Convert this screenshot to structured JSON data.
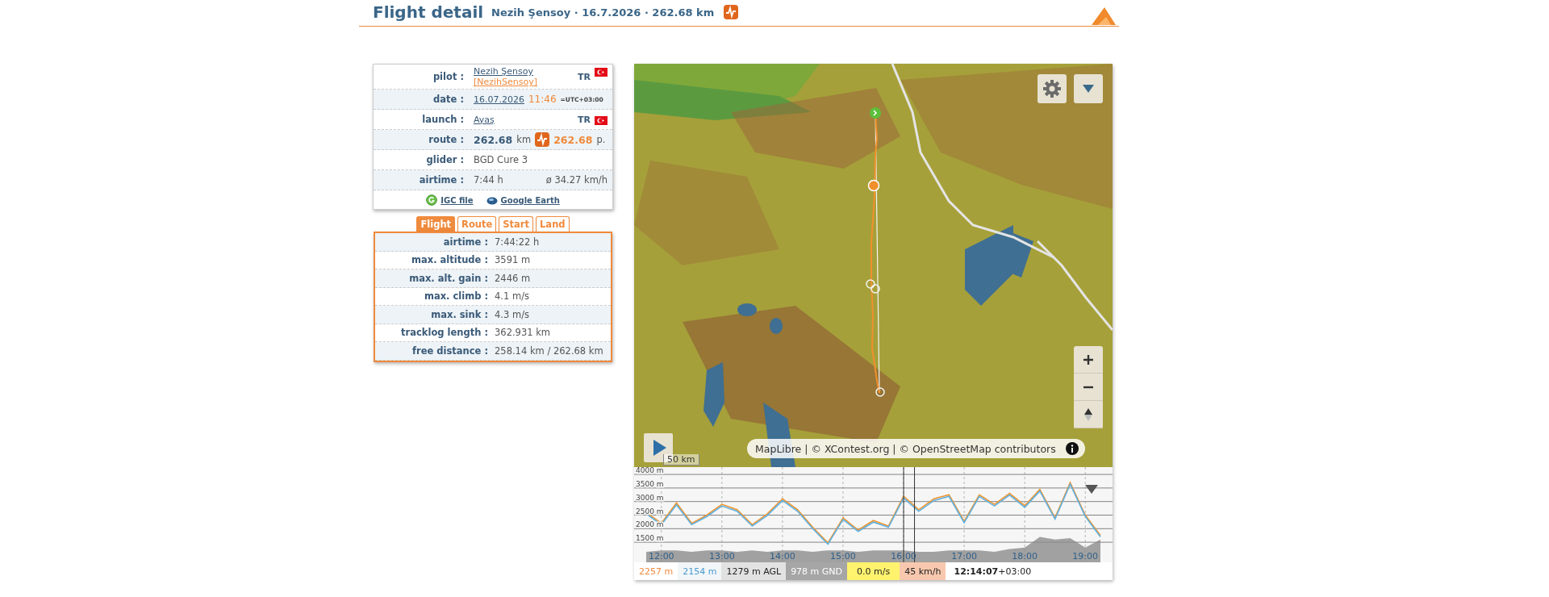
{
  "header": {
    "title": "Flight detail",
    "subtitle": "Nezih Şensoy · 16.7.2026 · 262.68 km"
  },
  "info": [
    {
      "kind": "pilot",
      "label": "pilot :",
      "name": "Nezih Şensoy",
      "username": "[NezihSensoy]",
      "country": "TR"
    },
    {
      "kind": "date",
      "label": "date :",
      "date": "16.07.2026",
      "time": "11:46",
      "zone": "=UTC+03:00"
    },
    {
      "kind": "launch",
      "label": "launch :",
      "place": "Ayaş",
      "country": "TR"
    },
    {
      "kind": "route",
      "label": "route :",
      "distance": "262.68",
      "unit": "km",
      "points": "262.68",
      "points_unit": "p."
    },
    {
      "kind": "plain",
      "label": "glider :",
      "value": "BGD Cure 3"
    },
    {
      "kind": "airtime",
      "label": "airtime :",
      "value": "7:44 h",
      "speed": "ø 34.27 km/h"
    }
  ],
  "links": [
    {
      "kind": "igc",
      "label": "IGC file"
    },
    {
      "kind": "earth",
      "label": "Google Earth"
    }
  ],
  "tabs": [
    {
      "label": "Flight",
      "selected": true
    },
    {
      "label": "Route",
      "selected": false
    },
    {
      "label": "Start",
      "selected": false
    },
    {
      "label": "Land",
      "selected": false
    }
  ],
  "stats": [
    {
      "label": "airtime :",
      "value": "7:44:22 h"
    },
    {
      "label": "max. altitude :",
      "value": "3591 m"
    },
    {
      "label": "max. alt. gain :",
      "value": "2446 m"
    },
    {
      "label": "max. climb :",
      "value": "4.1 m/s"
    },
    {
      "label": "max. sink :",
      "value": "4.3 m/s"
    },
    {
      "label": "tracklog length :",
      "value": "362.931 km"
    },
    {
      "label": "free distance :",
      "value": "258.14 km / 262.68 km"
    }
  ],
  "map": {
    "scale": "50 km",
    "attribution": "MapLibre | © XContest.org | © OpenStreetMap contributors",
    "chart_data": {
      "type": "line",
      "x": [
        11.75,
        12,
        12.25,
        12.5,
        12.75,
        13,
        13.25,
        13.5,
        13.75,
        14,
        14.25,
        14.5,
        14.75,
        15,
        15.25,
        15.5,
        15.75,
        16,
        16.25,
        16.5,
        16.75,
        17,
        17.25,
        17.5,
        17.75,
        18,
        18.25,
        18.5,
        18.75,
        19,
        19.25
      ],
      "series": [
        {
          "type": "line",
          "color": "#f0962e",
          "values": [
            2600,
            2200,
            2950,
            2200,
            2500,
            2900,
            2700,
            2150,
            2550,
            3100,
            2700,
            2050,
            1480,
            2400,
            1950,
            2300,
            2100,
            3200,
            2700,
            3100,
            3250,
            2270,
            3250,
            2900,
            3300,
            2850,
            3450,
            2400,
            3700,
            2500,
            1750
          ]
        },
        {
          "type": "line",
          "color": "#5fb0e0",
          "values": [
            2550,
            2150,
            2880,
            2150,
            2450,
            2840,
            2640,
            2100,
            2490,
            3040,
            2640,
            2000,
            1430,
            2340,
            1900,
            2240,
            2050,
            3130,
            2640,
            3040,
            3190,
            2220,
            3190,
            2840,
            3240,
            2790,
            3390,
            2350,
            3640,
            2450,
            1700
          ]
        },
        {
          "type": "area",
          "color": "#8c8c8c",
          "values": [
            1150,
            1200,
            1200,
            1150,
            1200,
            1200,
            1150,
            1200,
            1150,
            1200,
            1200,
            1150,
            1200,
            1200,
            1150,
            1200,
            1200,
            1200,
            1150,
            1150,
            1200,
            1200,
            1200,
            1150,
            1250,
            1300,
            1700,
            1600,
            1650,
            1300,
            1600
          ]
        }
      ],
      "xticks": [
        {
          "value": 12,
          "label": "12:00"
        },
        {
          "value": 13,
          "label": "13:00"
        },
        {
          "value": 14,
          "label": "14:00"
        },
        {
          "value": 15,
          "label": "15:00"
        },
        {
          "value": 16,
          "label": "16:00"
        },
        {
          "value": 17,
          "label": "17:00"
        },
        {
          "value": 18,
          "label": "18:00"
        },
        {
          "value": 19,
          "label": "19:00"
        }
      ],
      "yticks": [
        {
          "value": 1500,
          "label": "1500 m"
        },
        {
          "value": 2000,
          "label": "2000 m"
        },
        {
          "value": 2500,
          "label": "2500 m"
        },
        {
          "value": 3000,
          "label": "3000 m"
        },
        {
          "value": 3500,
          "label": "3500 m"
        },
        {
          "value": 4000,
          "label": "4000 m"
        }
      ],
      "xlim": [
        11.55,
        19.45
      ],
      "ylim": [
        760,
        4270
      ],
      "grid": true,
      "ref_lines": [
        {
          "axis": "x",
          "value": 16,
          "color": "#333333"
        },
        {
          "axis": "x",
          "value": 16.18,
          "color": "#333333"
        }
      ]
    }
  },
  "readouts": [
    {
      "kind": "gps",
      "text": "2257 m"
    },
    {
      "kind": "baro",
      "text": "2154 m"
    },
    {
      "kind": "agl",
      "text": "1279 m AGL"
    },
    {
      "kind": "gnd",
      "text": "978 m GND"
    },
    {
      "kind": "vario",
      "text": "0.0 m/s"
    },
    {
      "kind": "speed",
      "text": "45 km/h"
    },
    {
      "kind": "time",
      "text": "**12:14:07**+03:00"
    }
  ]
}
